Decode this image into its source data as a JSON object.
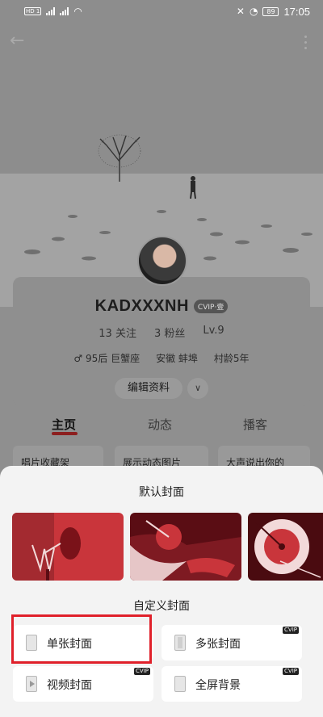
{
  "status_bar": {
    "network_left": [
      "HD 1",
      "HD 2"
    ],
    "network_labels": [
      "4G",
      "4G"
    ],
    "battery": "89",
    "time": "17:05"
  },
  "icons": {
    "back": "arrow-left-icon",
    "more": "vertical-dots-icon"
  },
  "profile": {
    "username": "KADXXXNH",
    "vip_badge": "CVIP·壹",
    "stats": {
      "follow": "13 关注",
      "fans": "3 粉丝",
      "level": "Lv.9"
    },
    "info": {
      "age_sign": "♂ 95后 巨蟹座",
      "location": "安徽 蚌埠",
      "village_age": "村龄5年"
    },
    "edit_label": "编辑资料",
    "edit_more": "∨"
  },
  "tabs": [
    {
      "label": "主页",
      "active": true
    },
    {
      "label": "动态",
      "active": false
    },
    {
      "label": "播客",
      "active": false
    }
  ],
  "cards": [
    "唱片收藏架",
    "展示动态图片",
    "大声说出你的"
  ],
  "sheet": {
    "default_title": "默认封面",
    "custom_title": "自定义封面",
    "options": [
      {
        "label": "单张封面",
        "vip": false,
        "icon": "single-image-icon"
      },
      {
        "label": "多张封面",
        "vip": true,
        "icon": "multi-image-icon"
      },
      {
        "label": "视频封面",
        "vip": true,
        "icon": "video-icon"
      },
      {
        "label": "全屏背景",
        "vip": true,
        "icon": "fullscreen-icon"
      }
    ],
    "vip_tag": "CVIP"
  },
  "colors": {
    "accent_red": "#e0202a",
    "cover_red": "#c9353b",
    "cover_dark": "#5a0d14",
    "tab_underline": "#8c1f1f"
  }
}
